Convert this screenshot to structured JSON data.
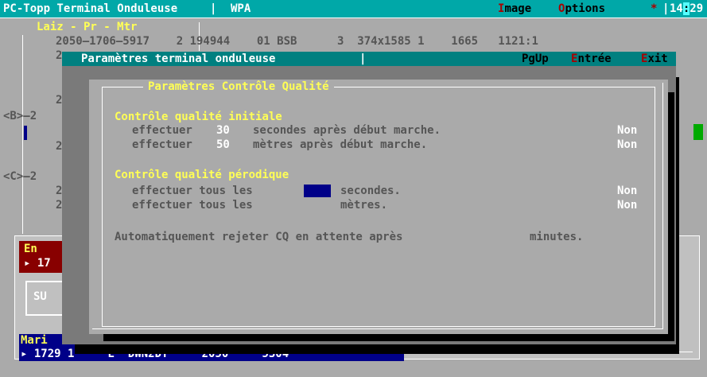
{
  "topbar": {
    "app_title": "PC-Topp Terminal Onduleuse",
    "separator": "|",
    "module": "WPA",
    "menu_image_first": "I",
    "menu_image_rest": "mage",
    "menu_options_first": "O",
    "menu_options_rest": "ptions",
    "star": "*",
    "bar": "|",
    "clock_h": "14",
    "clock_colon": ":",
    "clock_m": "29"
  },
  "background": {
    "header_label": "Laiz - Pr - Mtr",
    "row1": "2050—1706—5917    2 194944    01 BSB      3  374x1585 1    1665   1121:1",
    "row2_digit": "2",
    "rowB_label": "<B>—2",
    "rowB_digit2": "2",
    "rowB_digit3": "2",
    "rowC_label": "<C>—2",
    "rowC_digit2": "2",
    "rowC_digit3": "2",
    "en_label": "En",
    "en_value": "▸ 17",
    "su_label": "SU",
    "mari_label": "Mari",
    "mari_row": "▸ 1729 1     E  DWN2DT     2050     5304"
  },
  "outer_dialog": {
    "title": "Paramètres terminal onduleuse",
    "pgup": "PgUp",
    "entree_first": "E",
    "entree_rest": "ntrée",
    "exit_first": "E",
    "exit_rest": "xit"
  },
  "inner_dialog": {
    "frame_title": "Paramètres Contrôle Qualité",
    "section_initial": "Contrôle qualité initiale",
    "initial_rows": [
      {
        "prefix": "effectuer",
        "value": "30",
        "suffix": "secondes après début marche.",
        "status": "Non"
      },
      {
        "prefix": "effectuer",
        "value": "50",
        "suffix": "mètres après début marche.",
        "status": "Non"
      }
    ],
    "section_periodic": "Contrôle qualité pérodique",
    "periodic_rows": [
      {
        "prefix": "effectuer tous les",
        "suffix": "secondes.",
        "status": "Non"
      },
      {
        "prefix": "effectuer tous les",
        "suffix": "mètres.",
        "status": "Non"
      }
    ],
    "reject_text": "Automatiquement rejeter CQ en attente après",
    "reject_unit": "minutes."
  },
  "colors": {
    "title_bar": "#00a8a8",
    "dialog_title": "#008080",
    "section_heading": "#ffff55",
    "input_field": "#000088",
    "hotkey": "#aa0000"
  }
}
